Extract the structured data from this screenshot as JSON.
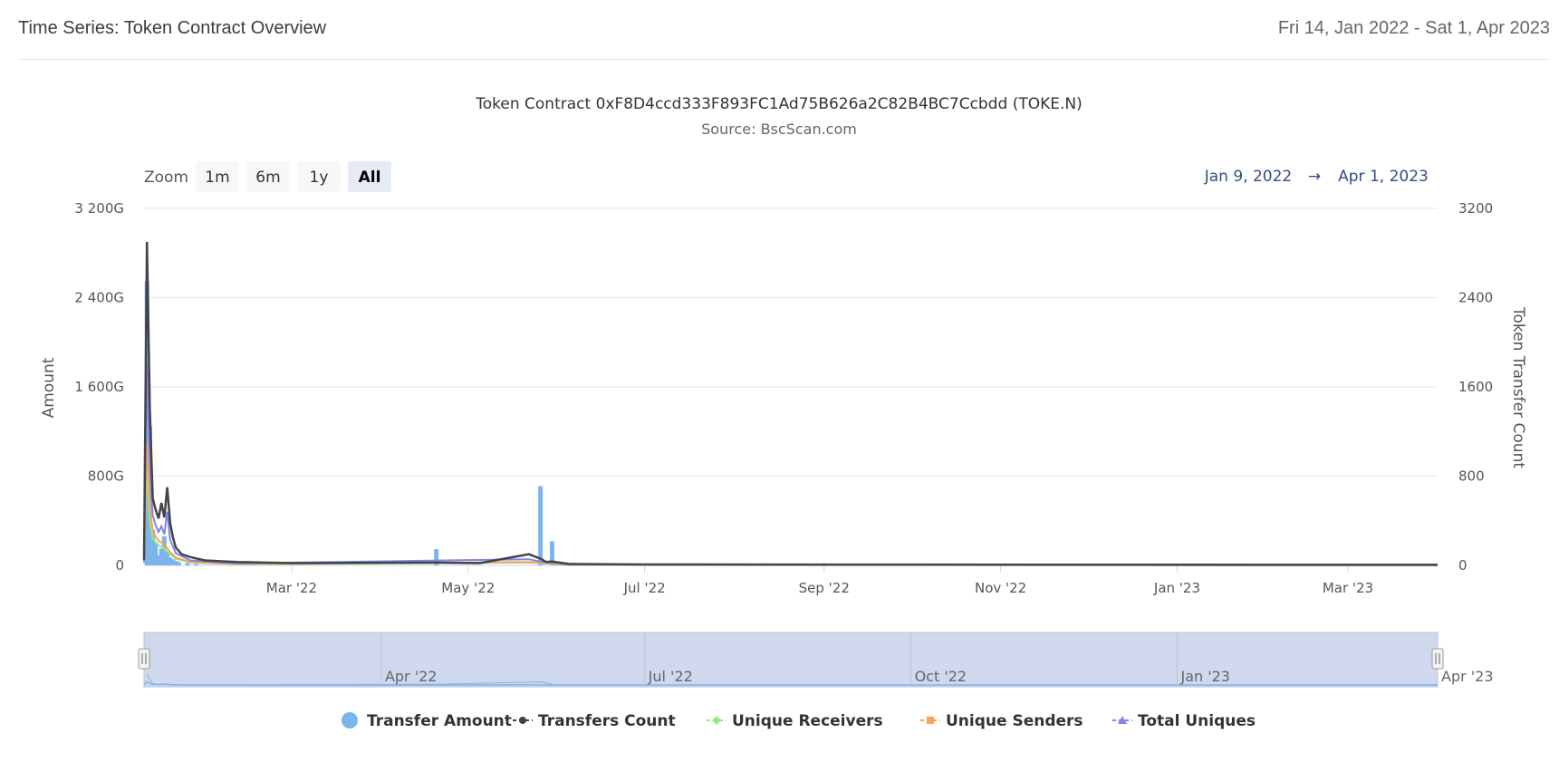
{
  "header": {
    "title": "Time Series: Token Contract Overview",
    "date_range": "Fri 14, Jan 2022 - Sat 1, Apr 2023"
  },
  "zoom": {
    "label": "Zoom",
    "buttons": [
      "1m",
      "6m",
      "1y",
      "All"
    ],
    "active": "All"
  },
  "range_selector": {
    "from": "Jan 9, 2022",
    "arrow": "→",
    "to": "Apr 1, 2023"
  },
  "navigator": {
    "ticks": [
      "Apr '22",
      "Jul '22",
      "Oct '22",
      "Jan '23",
      "Apr '23"
    ]
  },
  "colors": {
    "transfer_amount": "#7cb5ec",
    "transfers_count": "#434348",
    "unique_receivers": "#90ed7d",
    "unique_senders": "#f7a35c",
    "total_uniques": "#8085e9",
    "navigator_fill": "#cfd8ec",
    "range_text": "#334e83"
  },
  "chart_data": {
    "type": "bar",
    "title": "Token Contract 0xF8D4ccd333F893FC1Ad75B626a2C82B4BC7Ccbdd (TOKE.N)",
    "subtitle": "Source: BscScan.com",
    "x_range": [
      "2022-01-09",
      "2023-04-01"
    ],
    "x_ticks": [
      "Mar '22",
      "May '22",
      "Jul '22",
      "Sep '22",
      "Nov '22",
      "Jan '23",
      "Mar '23"
    ],
    "y_left": {
      "label": "Amount",
      "ticks": [
        "0",
        "800G",
        "1 600G",
        "2 400G",
        "3 200G"
      ],
      "range": [
        0,
        3200
      ]
    },
    "y_right": {
      "label": "Token Transfer Count",
      "ticks": [
        "0",
        "800",
        "1600",
        "2400",
        "3200"
      ],
      "range": [
        0,
        3200
      ]
    },
    "grid": true,
    "legend_position": "bottom",
    "series": [
      {
        "name": "Transfer Amount",
        "type": "column",
        "axis": "left",
        "points": [
          [
            "2022-01-10",
            2550
          ],
          [
            "2022-01-11",
            1250
          ],
          [
            "2022-01-12",
            320
          ],
          [
            "2022-01-13",
            200
          ],
          [
            "2022-01-14",
            90
          ],
          [
            "2022-01-15",
            150
          ],
          [
            "2022-01-16",
            260
          ],
          [
            "2022-01-17",
            120
          ],
          [
            "2022-01-18",
            70
          ],
          [
            "2022-01-19",
            55
          ],
          [
            "2022-01-20",
            40
          ],
          [
            "2022-01-21",
            30
          ],
          [
            "2022-01-24",
            20
          ],
          [
            "2022-01-27",
            12
          ],
          [
            "2022-04-20",
            145
          ],
          [
            "2022-05-26",
            710
          ],
          [
            "2022-05-30",
            215
          ]
        ]
      },
      {
        "name": "Transfers Count",
        "type": "line",
        "axis": "right",
        "points": [
          [
            "2022-01-09",
            50
          ],
          [
            "2022-01-10",
            2900
          ],
          [
            "2022-01-11",
            1400
          ],
          [
            "2022-01-12",
            600
          ],
          [
            "2022-01-13",
            500
          ],
          [
            "2022-01-14",
            420
          ],
          [
            "2022-01-15",
            560
          ],
          [
            "2022-01-16",
            430
          ],
          [
            "2022-01-17",
            700
          ],
          [
            "2022-01-18",
            380
          ],
          [
            "2022-01-19",
            250
          ],
          [
            "2022-01-20",
            160
          ],
          [
            "2022-01-22",
            100
          ],
          [
            "2022-01-25",
            75
          ],
          [
            "2022-01-30",
            45
          ],
          [
            "2022-02-10",
            30
          ],
          [
            "2022-03-01",
            20
          ],
          [
            "2022-04-20",
            25
          ],
          [
            "2022-05-05",
            20
          ],
          [
            "2022-05-22",
            100
          ],
          [
            "2022-05-26",
            60
          ],
          [
            "2022-05-28",
            30
          ],
          [
            "2022-05-30",
            35
          ],
          [
            "2022-06-05",
            12
          ],
          [
            "2022-07-01",
            8
          ],
          [
            "2023-04-01",
            5
          ]
        ]
      },
      {
        "name": "Unique Receivers",
        "type": "line",
        "axis": "right",
        "points": [
          [
            "2022-01-09",
            20
          ],
          [
            "2022-01-10",
            900
          ],
          [
            "2022-01-11",
            400
          ],
          [
            "2022-01-12",
            240
          ],
          [
            "2022-01-14",
            180
          ],
          [
            "2022-01-16",
            150
          ],
          [
            "2022-01-18",
            100
          ],
          [
            "2022-01-20",
            60
          ],
          [
            "2022-01-25",
            25
          ],
          [
            "2022-02-10",
            10
          ],
          [
            "2022-05-22",
            25
          ],
          [
            "2022-06-05",
            4
          ],
          [
            "2023-04-01",
            2
          ]
        ]
      },
      {
        "name": "Unique Senders",
        "type": "line",
        "axis": "right",
        "points": [
          [
            "2022-01-09",
            20
          ],
          [
            "2022-01-10",
            1100
          ],
          [
            "2022-01-11",
            550
          ],
          [
            "2022-01-12",
            300
          ],
          [
            "2022-01-14",
            220
          ],
          [
            "2022-01-16",
            190
          ],
          [
            "2022-01-18",
            120
          ],
          [
            "2022-01-20",
            70
          ],
          [
            "2022-01-25",
            30
          ],
          [
            "2022-02-10",
            12
          ],
          [
            "2022-05-22",
            30
          ],
          [
            "2022-06-05",
            5
          ],
          [
            "2023-04-01",
            2
          ]
        ]
      },
      {
        "name": "Total Uniques",
        "type": "line",
        "axis": "right",
        "points": [
          [
            "2022-01-09",
            30
          ],
          [
            "2022-01-10",
            1800
          ],
          [
            "2022-01-11",
            900
          ],
          [
            "2022-01-12",
            450
          ],
          [
            "2022-01-13",
            360
          ],
          [
            "2022-01-14",
            300
          ],
          [
            "2022-01-15",
            350
          ],
          [
            "2022-01-16",
            280
          ],
          [
            "2022-01-17",
            480
          ],
          [
            "2022-01-18",
            230
          ],
          [
            "2022-01-20",
            110
          ],
          [
            "2022-01-25",
            45
          ],
          [
            "2022-02-10",
            18
          ],
          [
            "2022-05-22",
            55
          ],
          [
            "2022-05-26",
            35
          ],
          [
            "2022-06-05",
            8
          ],
          [
            "2023-04-01",
            4
          ]
        ]
      }
    ]
  }
}
